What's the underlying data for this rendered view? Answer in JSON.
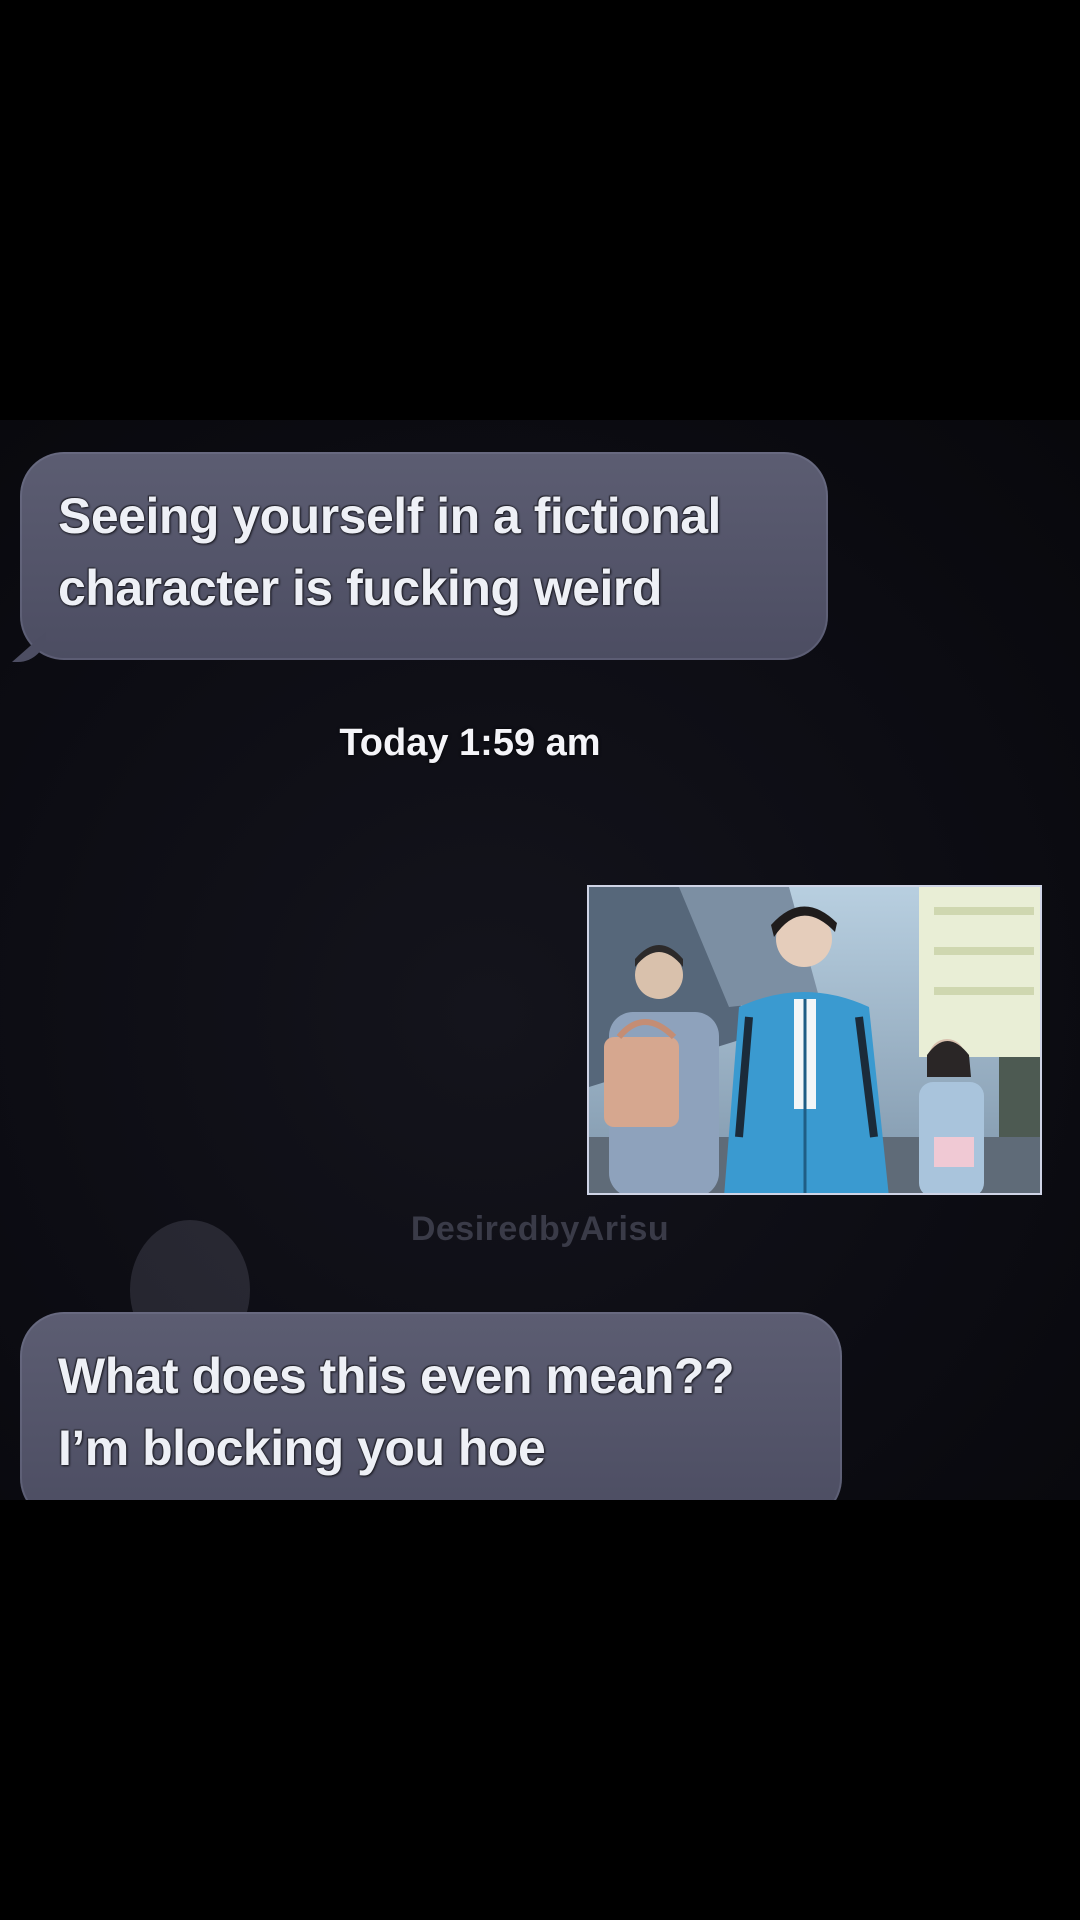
{
  "conversation": {
    "messages": [
      {
        "text": "Seeing yourself in a fictional\ncharacter is fucking weird"
      },
      {
        "text": "What does this even mean??\nI’m blocking you hoe"
      }
    ],
    "timestamp": "Today 1:59 am",
    "watermark": "DesiredbyArisu"
  },
  "colors": {
    "background": "#000000",
    "bubble": "#55566b",
    "text": "#eef0f6"
  }
}
